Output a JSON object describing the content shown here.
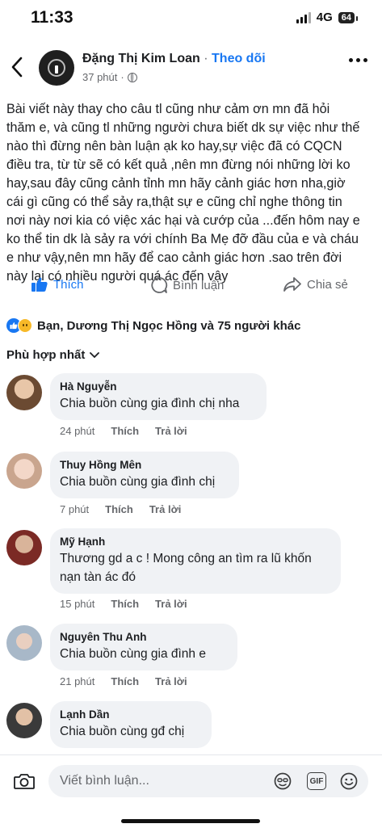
{
  "status": {
    "time": "11:33",
    "network": "4G",
    "battery": "64"
  },
  "header": {
    "author": "Đặng Thị Kim Loan",
    "separator": "·",
    "follow": "Theo dõi",
    "time": "37 phút",
    "time_sep": "·"
  },
  "post": {
    "body": "Bài viết này thay cho câu tl cũng như cảm ơn mn đã hỏi thăm e, và cũng tl những người chưa biết dk sự việc như thế nào thì đừng nên bàn luận ạk ko hay,sự việc đã có CQCN điều tra, từ từ sẽ có kết quả ,nên mn đừng nói những lời ko hay,sau đây cũng cảnh tỉnh mn hãy cảnh giác hơn nha,giờ cái gì cũng có thể sảy ra,thật sự e cũng chỉ nghe thông tin nơi này nơi kia có việc xác hại và cướp của ...đến hôm nay e ko thể tin dk là sảy ra với chính Ba Mẹ đỡ đầu của e và cháu e như vậy,nên mn hãy để cao cảnh giác hơn .sao trên đời này lại có nhiều người quá ác đến vậy"
  },
  "actions": {
    "like": "Thích",
    "comment": "Bình luận",
    "share": "Chia sẻ"
  },
  "reactions": {
    "summary": "Bạn, Dương Thị Ngọc Hồng và 75 người khác"
  },
  "sort": {
    "label": "Phù hợp nhất"
  },
  "comments": [
    {
      "name": "Hà Nguyễn",
      "text": "Chia buồn cùng gia đình chị nha",
      "time": "24 phút",
      "like": "Thích",
      "reply": "Trả lời"
    },
    {
      "name": "Thuy Hồng Mên",
      "text": "Chia buồn cùng gia đình chị",
      "time": "7 phút",
      "like": "Thích",
      "reply": "Trả lời"
    },
    {
      "name": "Mỹ Hạnh",
      "text": "Thương gd a c ! Mong công an tìm ra lũ khốn nạn tàn ác đó",
      "time": "15 phút",
      "like": "Thích",
      "reply": "Trả lời"
    },
    {
      "name": "Nguyên Thu Anh",
      "text": "Chia buồn cùng gia đình e",
      "time": "21 phút",
      "like": "Thích",
      "reply": "Trả lời"
    },
    {
      "name": "Lạnh Dần",
      "text": "Chia buồn cùng gđ chị"
    }
  ],
  "composer": {
    "placeholder": "Viết bình luận...",
    "gif": "GIF"
  }
}
